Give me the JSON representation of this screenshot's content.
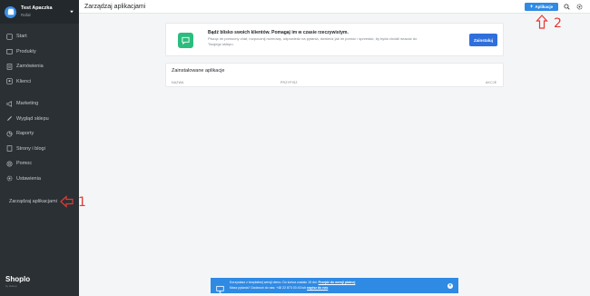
{
  "sidebar": {
    "store_name": "Test Apaczka",
    "store_user": "Rafał",
    "items": [
      {
        "label": "Start",
        "icon": "home-icon"
      },
      {
        "label": "Produkty",
        "icon": "box-icon"
      },
      {
        "label": "Zamówienia",
        "icon": "list-icon"
      },
      {
        "label": "Klienci",
        "icon": "users-icon"
      },
      {
        "label": "Marketing",
        "icon": "megaphone-icon"
      },
      {
        "label": "Wygląd sklepu",
        "icon": "brush-icon"
      },
      {
        "label": "Raporty",
        "icon": "chart-icon"
      },
      {
        "label": "Strony i blogi",
        "icon": "pages-icon"
      },
      {
        "label": "Pomoc",
        "icon": "help-icon"
      },
      {
        "label": "Ustawienia",
        "icon": "gear-icon"
      }
    ],
    "manage_apps": "Zarządzaj aplikacjami",
    "brand": "Shoplo",
    "brand_sub": "by skleep"
  },
  "header": {
    "title": "Zarządzaj aplikacjami",
    "apps_button": "Aplikacje"
  },
  "promo": {
    "heading": "Bądź blisko swoich klientów. Pomagaj im w czasie rzeczywistym.",
    "body": "Pisząc im pomocny chat, rozpocznij rozmowę, odpowiedz na pytania, dowiedz jak im pomóc i sprzedać, by byda chciali wracać do Twojego sklepu.",
    "button": "Zainstaluj"
  },
  "installed": {
    "title": "Zainstalowane aplikacje",
    "columns": [
      "NAZWA",
      "PRZYPISZ",
      "AKCJE"
    ]
  },
  "notice": {
    "text": "Korzystasz z bezpłatnej wersji demo. Do końca zostało 15 dni.",
    "link1": "Przejdź do wersji płatnej",
    "text2": "Masz pytania? Zadzwoń do nas: +48 22 873 03 43 lub",
    "link2": "napisz do nas"
  },
  "annotations": {
    "one": "1",
    "two": "2"
  },
  "colors": {
    "accent": "#2f8ae4",
    "sidebar": "#2b3034",
    "chat": "#2bbd7e",
    "annotation": "#e23a35"
  }
}
